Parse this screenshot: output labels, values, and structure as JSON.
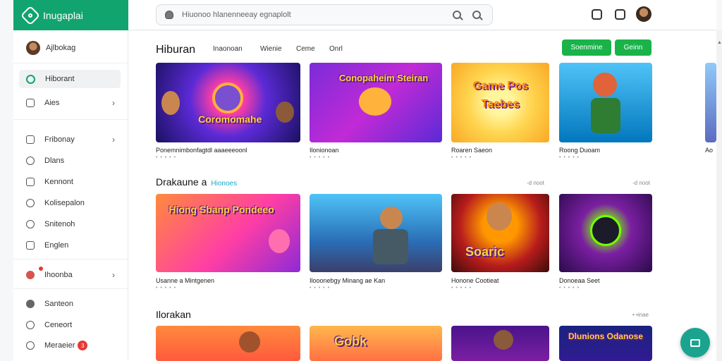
{
  "brand": {
    "name": "Inugaplai",
    "logo_icon": "diamond-logo-icon"
  },
  "search": {
    "placeholder": "Hiuonoo hlanenneeay egnaplolt"
  },
  "sidebar": {
    "items": [
      {
        "label": "Ajlbokag",
        "icon": "avatar"
      },
      {
        "label": "Hiborant",
        "icon": "chat-icon",
        "active": true
      },
      {
        "label": "Aies",
        "icon": "list-icon",
        "chevron": true
      },
      {
        "label": "Fribonay",
        "icon": "tag-icon",
        "chevron": true
      },
      {
        "label": "Dlans",
        "icon": "circle-icon"
      },
      {
        "label": "Kennont",
        "icon": "shield-icon"
      },
      {
        "label": "Kolisepalon",
        "icon": "globe-icon"
      },
      {
        "label": "Snitenoh",
        "icon": "circle-icon"
      },
      {
        "label": "Englen",
        "icon": "grid-icon"
      },
      {
        "label": "Ihoonba",
        "icon": "badge-avatar-icon",
        "chevron": true
      },
      {
        "label": "Santeon",
        "icon": "dot-icon"
      },
      {
        "label": "Ceneort",
        "icon": "pencil-icon"
      },
      {
        "label": "Meraeier",
        "icon": "pencil-icon",
        "badge": "3"
      }
    ]
  },
  "main": {
    "title": "Hiburan",
    "tabs": [
      "Inaonoan",
      "Wienie",
      "Ceme",
      "Onrl"
    ],
    "buttons": [
      "Soenmine",
      "Geinn"
    ],
    "row1": [
      {
        "title": "Ponemnimbonfagtdl aaaeeeoonl",
        "sub": "• • • • •"
      },
      {
        "title": "Ilonionoan",
        "sub": "• • • • •"
      },
      {
        "title": "Roaren Saeon",
        "sub": "• • • • •"
      },
      {
        "title": "Roong Duoam",
        "sub": "• • • • •"
      },
      {
        "title": "Ao",
        "sub": ""
      }
    ],
    "section2": {
      "title": "Drakaune a",
      "link": "Hionoes",
      "more": "-d noot"
    },
    "row2": [
      {
        "title": "Usanne a Mintgenen",
        "sub": "• • • • •"
      },
      {
        "title": "Ilooonebgy Minang ae Kan",
        "sub": "• • • • •"
      },
      {
        "title": "Honone Cootieat",
        "sub": "• • • • •"
      },
      {
        "title": "Donoeaa Seet",
        "sub": "• • • • •"
      }
    ],
    "section3": {
      "title": "Ilorakan",
      "more": "• •inae"
    },
    "row1_art": [
      "Coromomahe",
      "Conopaheim Steiran",
      "Game Pos Taebes",
      ""
    ],
    "row2_art": [
      "Hiong Sbanp Pondeeo",
      "",
      "Soaric",
      ""
    ],
    "row3_art": [
      "",
      "Gobk",
      "",
      "Dlunions Odanose"
    ]
  }
}
